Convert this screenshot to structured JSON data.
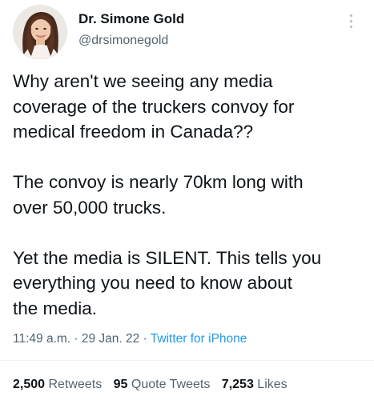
{
  "author": {
    "display_name": "Dr. Simone Gold",
    "handle": "@drsimonegold",
    "avatar_icon": "profile-photo"
  },
  "more_icon": "vertical-dots-icon",
  "tweet": {
    "paragraphs": [
      "Why aren't we seeing any media\ncoverage of the truckers convoy for\nmedical freedom in Canada??",
      "The convoy is nearly 70km long with\nover 50,000 trucks.",
      "Yet the media is SILENT. This tells you\neverything you need to know about\nthe media."
    ]
  },
  "meta": {
    "time": "11:49 a.m.",
    "sep1": " · ",
    "date": "29 Jan. 22",
    "sep2": " · ",
    "source": "Twitter for iPhone"
  },
  "stats": {
    "retweets_count": "2,500",
    "retweets_label": "Retweets",
    "quotes_count": "95",
    "quotes_label": "Quote Tweets",
    "likes_count": "7,253",
    "likes_label": "Likes"
  },
  "colors": {
    "text": "#0f1419",
    "secondary": "#536471",
    "link": "#1d9bf0"
  }
}
